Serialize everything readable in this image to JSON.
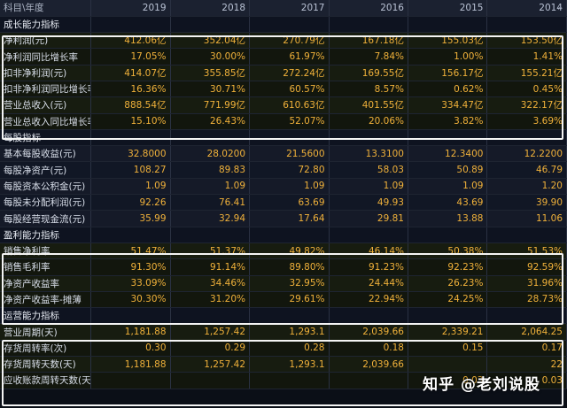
{
  "header": {
    "corner": "科目\\年度",
    "years": [
      "2019",
      "2018",
      "2017",
      "2016",
      "2015",
      "2014"
    ]
  },
  "sections": [
    {
      "title": "成长能力指标",
      "rows": [
        {
          "label": "净利润(元)",
          "values": [
            "412.06亿",
            "352.04亿",
            "270.79亿",
            "167.18亿",
            "155.03亿",
            "153.50亿"
          ]
        },
        {
          "label": "净利润同比增长率",
          "values": [
            "17.05%",
            "30.00%",
            "61.97%",
            "7.84%",
            "1.00%",
            "1.41%"
          ]
        },
        {
          "label": "扣非净利润(元)",
          "values": [
            "414.07亿",
            "355.85亿",
            "272.24亿",
            "169.55亿",
            "156.17亿",
            "155.21亿"
          ]
        },
        {
          "label": "扣非净利润同比增长率",
          "values": [
            "16.36%",
            "30.71%",
            "60.57%",
            "8.57%",
            "0.62%",
            "0.45%"
          ]
        },
        {
          "label": "营业总收入(元)",
          "values": [
            "888.54亿",
            "771.99亿",
            "610.63亿",
            "401.55亿",
            "334.47亿",
            "322.17亿"
          ]
        },
        {
          "label": "营业总收入同比增长率",
          "values": [
            "15.10%",
            "26.43%",
            "52.07%",
            "20.06%",
            "3.82%",
            "3.69%"
          ]
        }
      ]
    },
    {
      "title": "每股指标",
      "rows": [
        {
          "label": "基本每股收益(元)",
          "values": [
            "32.8000",
            "28.0200",
            "21.5600",
            "13.3100",
            "12.3400",
            "12.2200"
          ]
        },
        {
          "label": "每股净资产(元)",
          "values": [
            "108.27",
            "89.83",
            "72.80",
            "58.03",
            "50.89",
            "46.79"
          ]
        },
        {
          "label": "每股资本公积金(元)",
          "values": [
            "1.09",
            "1.09",
            "1.09",
            "1.09",
            "1.09",
            "1.20"
          ]
        },
        {
          "label": "每股未分配利润(元)",
          "values": [
            "92.26",
            "76.41",
            "63.69",
            "49.93",
            "43.69",
            "39.90"
          ]
        },
        {
          "label": "每股经营现金流(元)",
          "values": [
            "35.99",
            "32.94",
            "17.64",
            "29.81",
            "13.88",
            "11.06"
          ]
        }
      ]
    },
    {
      "title": "盈利能力指标",
      "rows": [
        {
          "label": "销售净利率",
          "values": [
            "51.47%",
            "51.37%",
            "49.82%",
            "46.14%",
            "50.38%",
            "51.53%"
          ]
        },
        {
          "label": "销售毛利率",
          "values": [
            "91.30%",
            "91.14%",
            "89.80%",
            "91.23%",
            "92.23%",
            "92.59%"
          ]
        },
        {
          "label": "净资产收益率",
          "values": [
            "33.09%",
            "34.46%",
            "32.95%",
            "24.44%",
            "26.23%",
            "31.96%"
          ]
        },
        {
          "label": "净资产收益率-摊薄",
          "values": [
            "30.30%",
            "31.20%",
            "29.61%",
            "22.94%",
            "24.25%",
            "28.73%"
          ]
        }
      ]
    },
    {
      "title": "运营能力指标",
      "rows": [
        {
          "label": "营业周期(天)",
          "values": [
            "1,181.88",
            "1,257.42",
            "1,293.1",
            "2,039.66",
            "2,339.21",
            "2,064.25"
          ]
        },
        {
          "label": "存货周转率(次)",
          "values": [
            "0.30",
            "0.29",
            "0.28",
            "0.18",
            "0.15",
            "0.17"
          ]
        },
        {
          "label": "存货周转天数(天)",
          "values": [
            "1,181.88",
            "1,257.42",
            "1,293.1",
            "2,039.66",
            "",
            "22"
          ]
        },
        {
          "label": "应收账款周转天数(天)",
          "values": [
            "",
            "",
            "",
            "",
            "0.03",
            "0.03"
          ]
        }
      ]
    }
  ],
  "watermark": "知乎 @老刘说股",
  "icons": {
    "scroll": "double-chevron-right-icon"
  },
  "colors": {
    "value": "#f0b13a",
    "highlight_box": "#f4f4f4",
    "background": "#0b0f17"
  }
}
